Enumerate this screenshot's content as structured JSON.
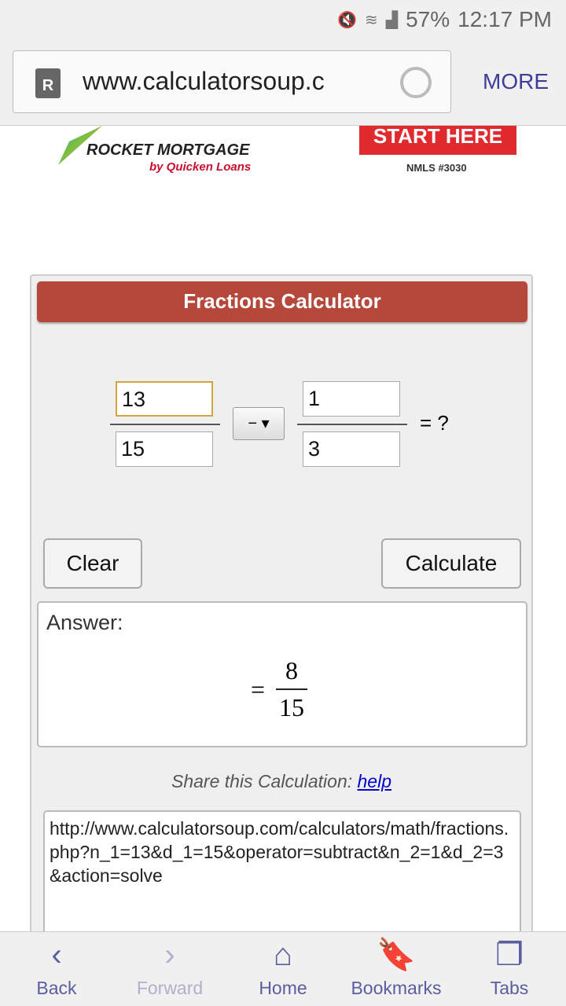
{
  "status": {
    "icons": [
      "mute-icon",
      "wifi-icon",
      "lte-icon",
      "signal-icon"
    ],
    "battery": "57%",
    "time": "12:17 PM"
  },
  "browser": {
    "url": "www.calculatorsoup.c",
    "more": "MORE"
  },
  "ad": {
    "brand": "ROCKET MORTGAGE",
    "sub": "by Quicken Loans",
    "cta": "START HERE",
    "nmls": "NMLS #3030"
  },
  "calculator": {
    "title": "Fractions Calculator",
    "n1": "13",
    "d1": "15",
    "operator": "− ▾",
    "n2": "1",
    "d2": "3",
    "equals": "= ?",
    "clear": "Clear",
    "calculate": "Calculate",
    "answer_label": "Answer:",
    "answer_eq": "=",
    "answer_num": "8",
    "answer_den": "15",
    "share_text": "Share this Calculation:",
    "help": "help",
    "share_url": "http://www.calculatorsoup.com/calculators/math/fractions.php?n_1=13&d_1=15&operator=subtract&n_2=1&d_2=3&action=solve"
  },
  "nav": [
    {
      "label": "Back",
      "icon": "‹"
    },
    {
      "label": "Forward",
      "icon": "›"
    },
    {
      "label": "Home",
      "icon": "⌂"
    },
    {
      "label": "Bookmarks",
      "icon": "🔖"
    },
    {
      "label": "Tabs",
      "icon": "❐"
    }
  ],
  "colors": {
    "accent": "#5a5d9e",
    "header": "#b5483a"
  }
}
